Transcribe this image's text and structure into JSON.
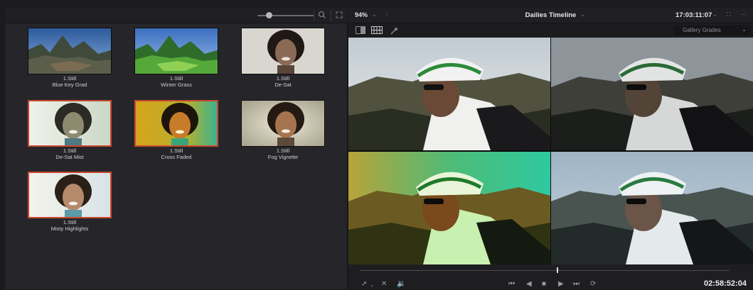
{
  "gallery": {
    "toolbar": {
      "zoom_slider": "gallery-zoom",
      "icons": [
        "search-icon",
        "expand-icon"
      ]
    },
    "stills": [
      {
        "label": "1.Still",
        "name": "Blue Key Grad",
        "kind": "landscape-blue"
      },
      {
        "label": "1.Still",
        "name": "Winter Grass",
        "kind": "landscape-green"
      },
      {
        "label": "1.Still",
        "name": "De-Sat",
        "kind": "portrait-desat"
      },
      {
        "label": "1.Still",
        "name": "De-Sat Mist",
        "kind": "portrait-mist",
        "selected": true
      },
      {
        "label": "1.Still",
        "name": "Cross Faded",
        "kind": "portrait-yellow",
        "selected": true
      },
      {
        "label": "1.Still",
        "name": "Fog Vignette",
        "kind": "portrait-fog"
      },
      {
        "label": "1.Still",
        "name": "Misty Highlights",
        "kind": "portrait-misty",
        "selected": true
      }
    ]
  },
  "viewer": {
    "zoom": "94%",
    "title": "Dailies Timeline",
    "timecode_top": "17:03:11:07",
    "gallery_dropdown": "Gallery Grades",
    "timecode_bottom": "02:58:52:04",
    "panels": [
      "original",
      "desaturated",
      "cross-faded-green",
      "cool-grade"
    ]
  }
}
